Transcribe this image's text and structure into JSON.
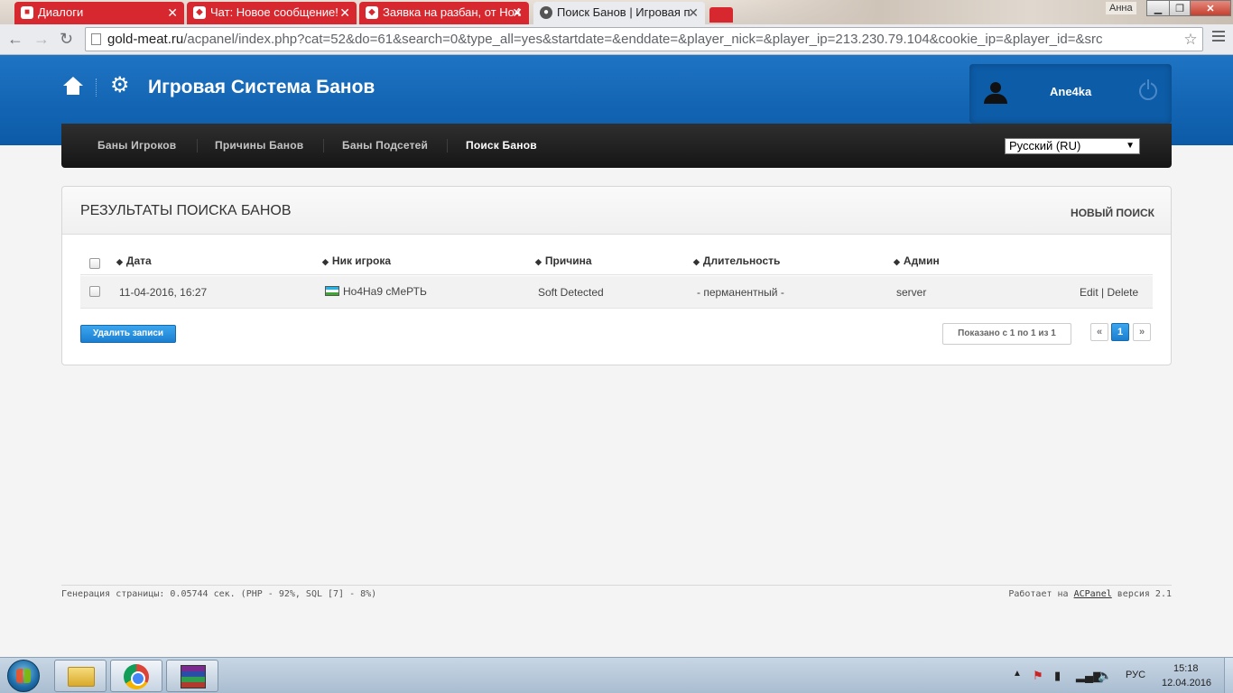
{
  "browser": {
    "tabs": [
      {
        "label": "Диалоги",
        "icon": "vk-icon"
      },
      {
        "label": "Чат: Новое сообщение!",
        "icon": "wolf-icon"
      },
      {
        "label": "Заявка на разбан, от Но4",
        "icon": "wolf-icon"
      },
      {
        "label": "Поиск Банов | Игровая п",
        "icon": "globe-icon"
      }
    ],
    "user_chip": "Анна",
    "url_host": "gold-meat.ru",
    "url_path": "/acpanel/index.php?cat=52&do=61&search=0&type_all=yes&startdate=&enddate=&player_nick=&player_ip=213.230.79.104&cookie_ip=&player_id=&src"
  },
  "header": {
    "title": "Игровая Система Банов",
    "user_name": "Ane4ka"
  },
  "nav": {
    "items": [
      "Баны Игроков",
      "Причины Банов",
      "Баны Подсетей",
      "Поиск Банов"
    ],
    "current": "Поиск Банов",
    "language": "Русский (RU)"
  },
  "panel": {
    "title": "РЕЗУЛЬТАТЫ ПОИСКА БАНОВ",
    "new_search": "НОВЫЙ ПОИСК",
    "columns": [
      "Дата",
      "Ник игрока",
      "Причина",
      "Длительность",
      "Админ"
    ],
    "rows": [
      {
        "date": "11-04-2016, 16:27",
        "nick": "Но4На9 сМеРТЬ",
        "reason": "Soft Detected",
        "duration": "- перманентный -",
        "admin": "server",
        "edit": "Edit",
        "action_sep": "|",
        "delete": "Delete"
      }
    ],
    "delete_button": "Удалить записи",
    "shown_info": "Показано с 1 по 1 из 1",
    "pagination": {
      "prev": "«",
      "page": "1",
      "next": "»"
    }
  },
  "footer": {
    "left": "Генерация страницы: 0.05744 сек. (PHP - 92%, SQL [7] - 8%)",
    "right_prefix": "Работает на",
    "right_link": "ACPanel",
    "right_suffix": "версия 2.1"
  },
  "taskbar": {
    "lang": "РУС",
    "time": "15:18",
    "date": "12.04.2016"
  }
}
